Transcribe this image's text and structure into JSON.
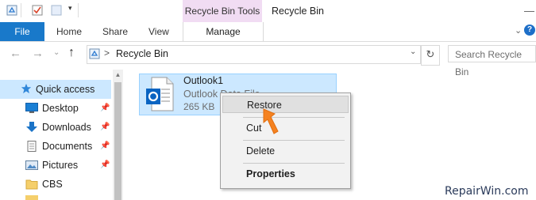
{
  "quick_access_toolbar": {
    "icons": [
      "recycle-bin-icon",
      "properties-icon",
      "new-folder-icon",
      "dropdown-icon"
    ]
  },
  "ribbon": {
    "contextual_group": "Recycle Bin Tools",
    "window_title": "Recycle Bin",
    "tabs": {
      "file": "File",
      "home": "Home",
      "share": "Share",
      "view": "View",
      "manage": "Manage"
    },
    "accent": "#1979ca",
    "contextual_color": "#f1dcf3"
  },
  "address_bar": {
    "path_separator": ">",
    "location": "Recycle Bin",
    "search_placeholder": "Search Recycle Bin"
  },
  "navigation": {
    "items": [
      {
        "label": "Quick access",
        "icon": "star-icon",
        "pinned": false,
        "selected": true
      },
      {
        "label": "Desktop",
        "icon": "desktop-icon",
        "pinned": true
      },
      {
        "label": "Downloads",
        "icon": "download-icon",
        "pinned": true
      },
      {
        "label": "Documents",
        "icon": "documents-icon",
        "pinned": true
      },
      {
        "label": "Pictures",
        "icon": "pictures-icon",
        "pinned": true
      },
      {
        "label": "CBS",
        "icon": "folder-icon",
        "pinned": false
      }
    ]
  },
  "selected_file": {
    "name": "Outlook1",
    "type": "Outlook Data File",
    "size": "265 KB"
  },
  "context_menu": {
    "items": [
      "Restore",
      "Cut",
      "Delete",
      "Properties"
    ]
  },
  "watermark": "RepairWin.com"
}
